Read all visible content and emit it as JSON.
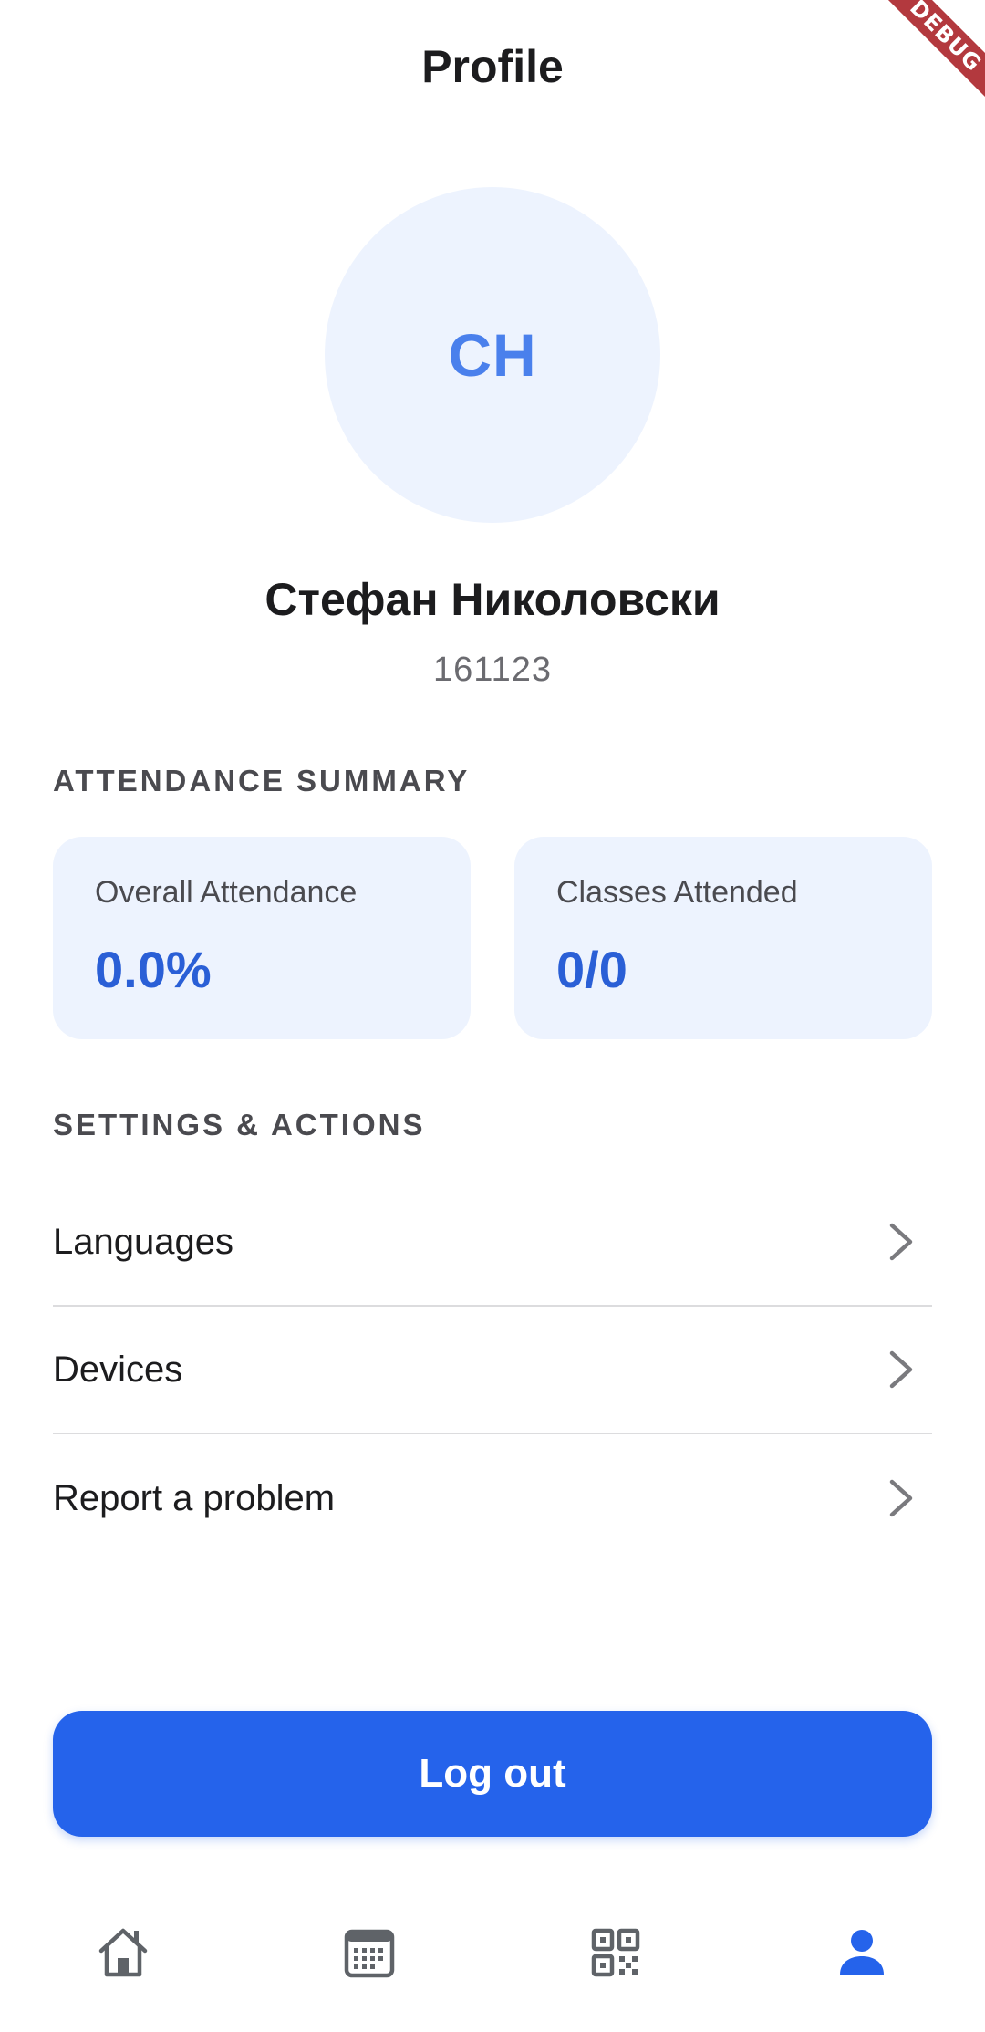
{
  "debug_banner": "DEBUG",
  "header": {
    "title": "Profile"
  },
  "profile": {
    "initials": "CH",
    "name": "Стефан Николовски",
    "id": "161123"
  },
  "attendance": {
    "section_title": "ATTENDANCE SUMMARY",
    "cards": [
      {
        "label": "Overall Attendance",
        "value": "0.0%"
      },
      {
        "label": "Classes Attended",
        "value": "0/0"
      }
    ]
  },
  "settings": {
    "section_title": "SETTINGS & ACTIONS",
    "items": [
      {
        "label": "Languages",
        "icon": "chevron-right-icon"
      },
      {
        "label": "Devices",
        "icon": "chevron-right-icon"
      },
      {
        "label": "Report a problem",
        "icon": "chevron-right-icon"
      }
    ]
  },
  "logout": {
    "label": "Log out"
  },
  "bottom_nav": {
    "items": [
      {
        "icon": "home-icon",
        "active": false
      },
      {
        "icon": "calendar-icon",
        "active": false
      },
      {
        "icon": "qr-code-icon",
        "active": false
      },
      {
        "icon": "person-icon",
        "active": true
      }
    ]
  },
  "colors": {
    "accent": "#2563eb",
    "card_background": "#edf3fe",
    "avatar_text": "#4a80ec",
    "nav_inactive": "#5f6368",
    "debug_ribbon": "#b3393e"
  }
}
